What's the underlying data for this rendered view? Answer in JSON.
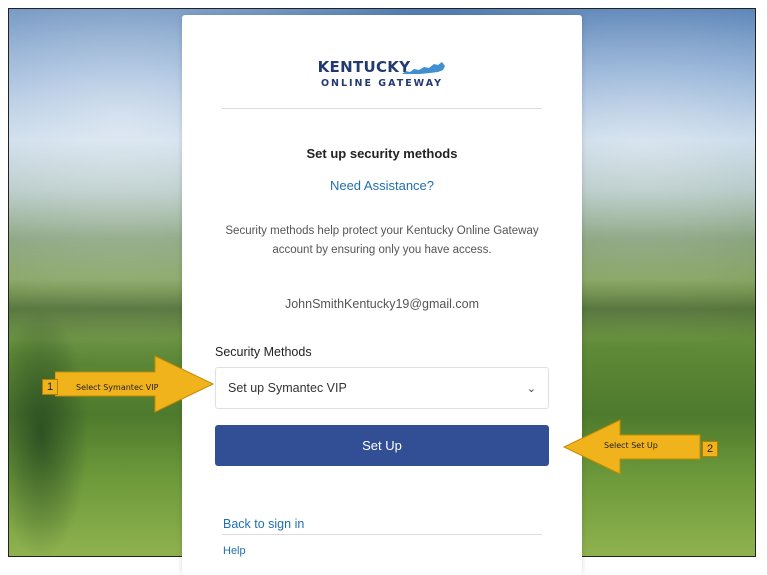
{
  "logo": {
    "main": "KENTUCKY",
    "sub": "ONLINE GATEWAY"
  },
  "page": {
    "title": "Set up security methods",
    "assistance_link": "Need Assistance?",
    "description": "Security methods help protect your Kentucky Online Gateway account by ensuring only you have access.",
    "email": "JohnSmithKentucky19@gmail.com"
  },
  "form": {
    "methods_label": "Security Methods",
    "selected_method": "Set up Symantec VIP",
    "submit_label": "Set Up"
  },
  "footer": {
    "back_link": "Back to sign in",
    "help_link": "Help"
  },
  "annotations": {
    "step1_number": "1",
    "step1_text": "Select Symantec VIP",
    "step2_number": "2",
    "step2_text": "Select Set Up",
    "color": "#f1b31c"
  },
  "colors": {
    "brand_navy": "#233a70",
    "button": "#324f95",
    "link": "#1f6fb3"
  }
}
